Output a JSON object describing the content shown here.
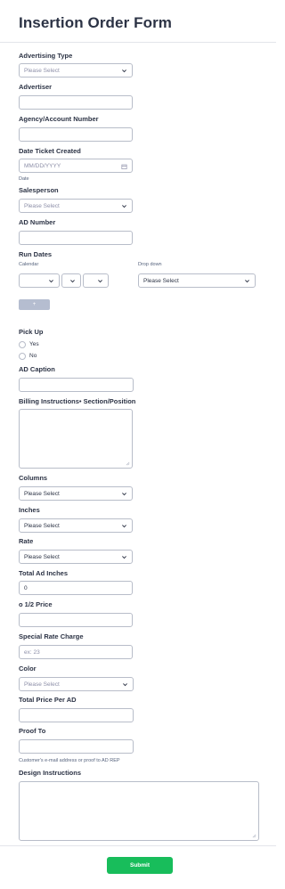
{
  "form": {
    "title": "Insertion Order Form",
    "advertising_type": {
      "label": "Advertising Type",
      "placeholder": "Please Select"
    },
    "advertiser": {
      "label": "Advertiser",
      "value": ""
    },
    "agency_number": {
      "label": "Agency/Account Number",
      "value": ""
    },
    "date_ticket": {
      "label": "Date Ticket Created",
      "placeholder": "MM/DD/YYYY",
      "sublabel": "Date"
    },
    "salesperson": {
      "label": "Salesperson",
      "placeholder": "Please Select"
    },
    "ad_number": {
      "label": "AD Number",
      "value": ""
    },
    "run_dates": {
      "label": "Run Dates",
      "col_calendar": "Calendar",
      "col_dropdown": "Drop down",
      "dropdown_value": "Please Select",
      "add_button": "+"
    },
    "pick_up": {
      "label": "Pick Up",
      "options": [
        "Yes",
        "No"
      ]
    },
    "ad_caption": {
      "label": "AD Caption",
      "value": ""
    },
    "billing": {
      "label": "Billing Instructions• Section/Position",
      "value": ""
    },
    "columns": {
      "label": "Columns",
      "value": "Please Select"
    },
    "inches": {
      "label": "Inches",
      "value": "Please Select"
    },
    "rate": {
      "label": "Rate",
      "value": "Please Select"
    },
    "total_ad_inches": {
      "label": "Total Ad Inches",
      "value": "0"
    },
    "half_price": {
      "label": "o 1/2 Price",
      "value": ""
    },
    "special_rate": {
      "label": "Special Rate Charge",
      "placeholder": "ex: 23"
    },
    "color": {
      "label": "Color",
      "placeholder": "Please Select"
    },
    "total_price": {
      "label": "Total Price Per AD",
      "value": ""
    },
    "proof_to": {
      "label": "Proof To",
      "value": "",
      "sublabel": "Customer's e-mail address or proof to AD REP"
    },
    "design": {
      "label": "Design Instructions",
      "value": ""
    },
    "submit_label": "Submit"
  },
  "colors": {
    "submit": "#18bd5b",
    "add_button": "#b5bdd0",
    "border": "#b8bdc9",
    "text": "#2c3345"
  }
}
